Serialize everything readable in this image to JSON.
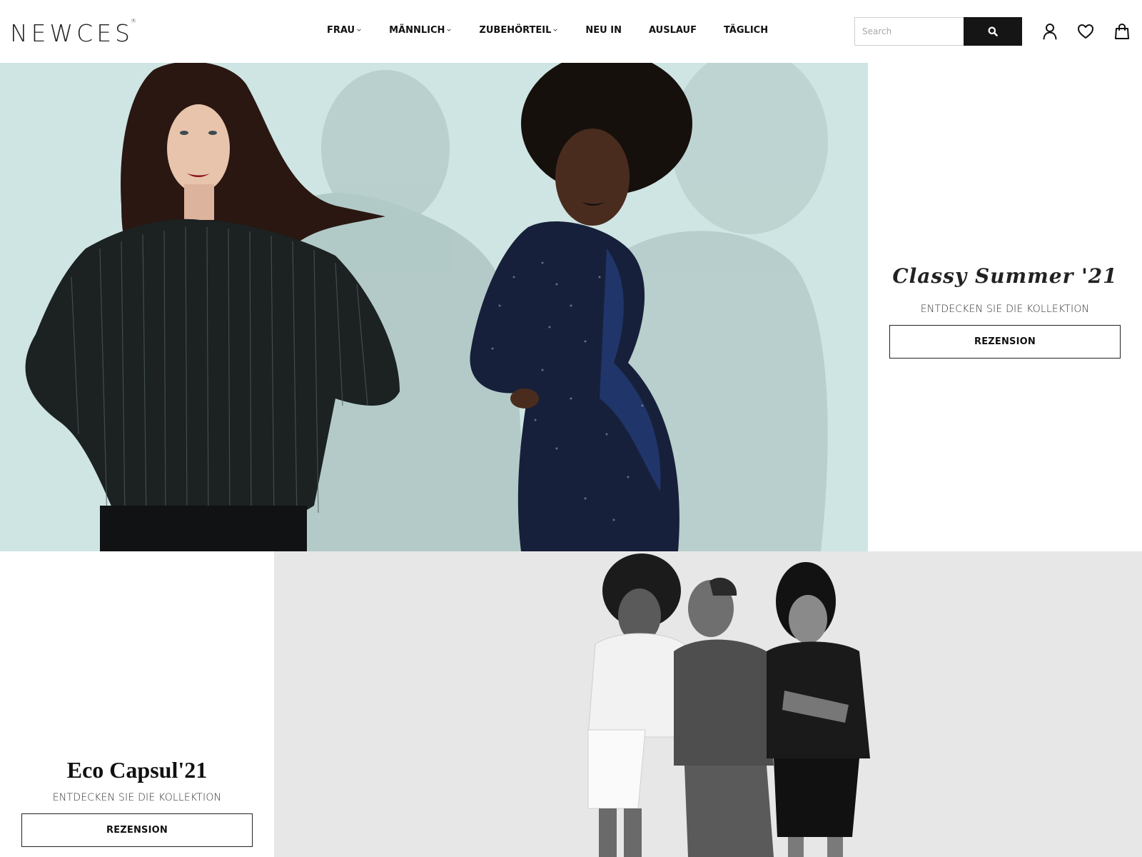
{
  "header": {
    "logo": "NEWCES",
    "logo_mark": "®",
    "nav": [
      {
        "label": "FRAU",
        "has_dropdown": true
      },
      {
        "label": "MÄNNLICH",
        "has_dropdown": true
      },
      {
        "label": "ZUBEHÖRTEIL",
        "has_dropdown": true
      },
      {
        "label": "NEU IN",
        "has_dropdown": false
      },
      {
        "label": "AUSLAUF",
        "has_dropdown": false
      },
      {
        "label": "TÄGLICH",
        "has_dropdown": false
      }
    ],
    "search": {
      "placeholder": "Search",
      "value": "",
      "button_icon": "search-icon"
    },
    "icons": [
      "user-icon",
      "heart-icon",
      "shopping-bag-icon"
    ]
  },
  "hero_1": {
    "image": "two-women-sequin-dresses",
    "title": "Classy Summer '21",
    "subtitle": "ENTDECKEN SIE DIE KOLLEKTION",
    "button_label": "REZENSION"
  },
  "hero_2": {
    "image": "three-models-monochrome-casualwear",
    "title": "Eco Capsul'21",
    "subtitle": "ENTDECKEN SIE DIE KOLLEKTION",
    "button_label": "REZENSION"
  },
  "colors": {
    "hero_1_background": "#cfe5e3",
    "hero_2_background": "#e7e7e7",
    "search_button": "#151515"
  }
}
